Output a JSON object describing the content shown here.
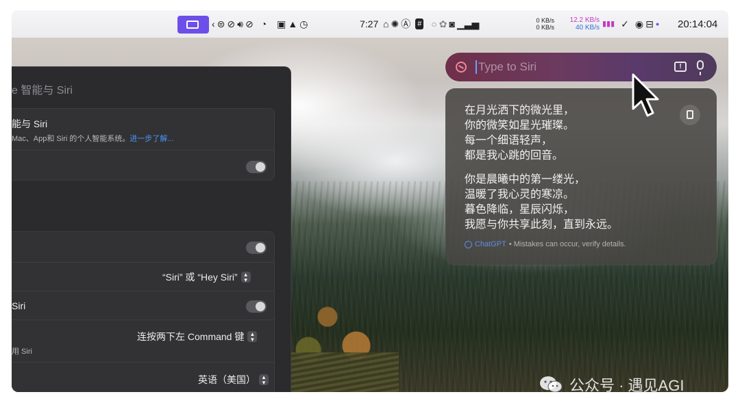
{
  "menubar": {
    "clock_short": "7:27",
    "net_up_a": "0 KB/s",
    "net_down_a": "0 KB/s",
    "net_up_b": "12.2 KB/s",
    "net_down_b": "40 KB/s",
    "clock": "20:14:04",
    "icons": [
      "ai-app-icon",
      "back-chevron-icon",
      "sync-icon",
      "route-icon",
      "volume-icon",
      "no-compass-icon",
      "timer-icon",
      "inbox-icon",
      "mountains-icon",
      "clock-icon",
      "home-icon",
      "chatgpt-icon",
      "a-icon",
      "hash-icon",
      "circle-icon",
      "flower-icon",
      "camera-icon",
      "bars-icon",
      "check-icon",
      "record-icon",
      "toggle-icon"
    ]
  },
  "settings": {
    "title": "e 智能与 Siri",
    "section_title": "能与 Siri",
    "section_desc": " Mac、App和 Siri 的个人智能系统。",
    "learn_more": "进一步了解...",
    "popup_siri": "“Siri” 或 “Hey Siri”",
    "label_siri": "Siri",
    "popup_command": "连按两下左 Command 键",
    "sub_siri": "用 Siri",
    "popup_language": "英语（美国）"
  },
  "siri": {
    "placeholder": "Type to Siri"
  },
  "response": {
    "stanza1": [
      "在月光洒下的微光里，",
      "你的微笑如星光璀璨。",
      "每一个细语轻声，",
      "都是我心跳的回音。"
    ],
    "stanza2": [
      "你是晨曦中的第一缕光，",
      "温暖了我心灵的寒凉。",
      "暮色降临，星辰闪烁，",
      "我愿与你共享此刻，直到永远。"
    ],
    "provider": "ChatGPT",
    "disclaimer": "• Mistakes can occur, verify details."
  },
  "watermark": {
    "text": "公众号 · 遇见AGI"
  },
  "colors": {
    "accent_purple": "#6b4fe8",
    "link_blue": "#4b95f5",
    "net_pink": "#c23bc0",
    "net_blue": "#2f6fd6"
  }
}
